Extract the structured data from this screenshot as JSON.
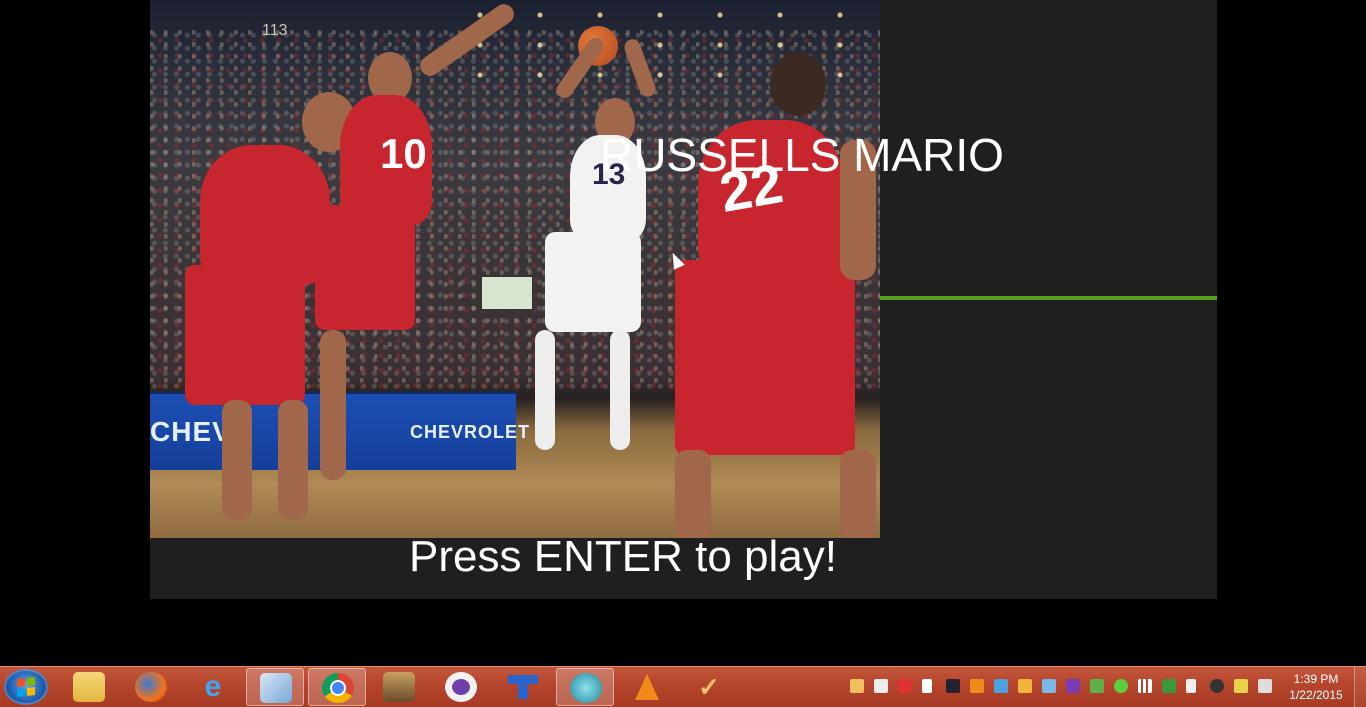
{
  "game": {
    "title": "RUSSELLS MARIO",
    "prompt": "Press ENTER to play!",
    "loading_progress": 1.0,
    "colors": {
      "panel": "#1f1f1f",
      "progress": "#5aa11b",
      "text": "#ffffff"
    },
    "photo": {
      "board_text_left": "CHEVR",
      "board_text_right": "CHEVROLET",
      "section_number": "113",
      "players": [
        {
          "team": "red",
          "number": "10"
        },
        {
          "team": "white",
          "number": "13"
        },
        {
          "team": "red",
          "number": "22"
        }
      ]
    }
  },
  "taskbar": {
    "start_icon": "windows-start-orb",
    "pinned": [
      {
        "name": "windows-explorer",
        "icon": "folder-icon"
      },
      {
        "name": "firefox",
        "icon": "firefox-icon"
      },
      {
        "name": "internet-explorer",
        "icon": "ie-icon"
      },
      {
        "name": "virtualbox",
        "icon": "cube-icon",
        "active": true
      },
      {
        "name": "chrome",
        "icon": "chrome-icon",
        "active": true
      },
      {
        "name": "game-app",
        "icon": "character-icon"
      },
      {
        "name": "cat-app",
        "icon": "cat-icon"
      },
      {
        "name": "tetris-app",
        "icon": "t-block-icon"
      },
      {
        "name": "network-app",
        "icon": "globe-icon",
        "active": true
      },
      {
        "name": "vlc",
        "icon": "cone-icon"
      },
      {
        "name": "checkmark-app",
        "icon": "check-icon"
      }
    ],
    "clock": {
      "time": "1:39 PM",
      "date": "1/22/2015"
    }
  }
}
